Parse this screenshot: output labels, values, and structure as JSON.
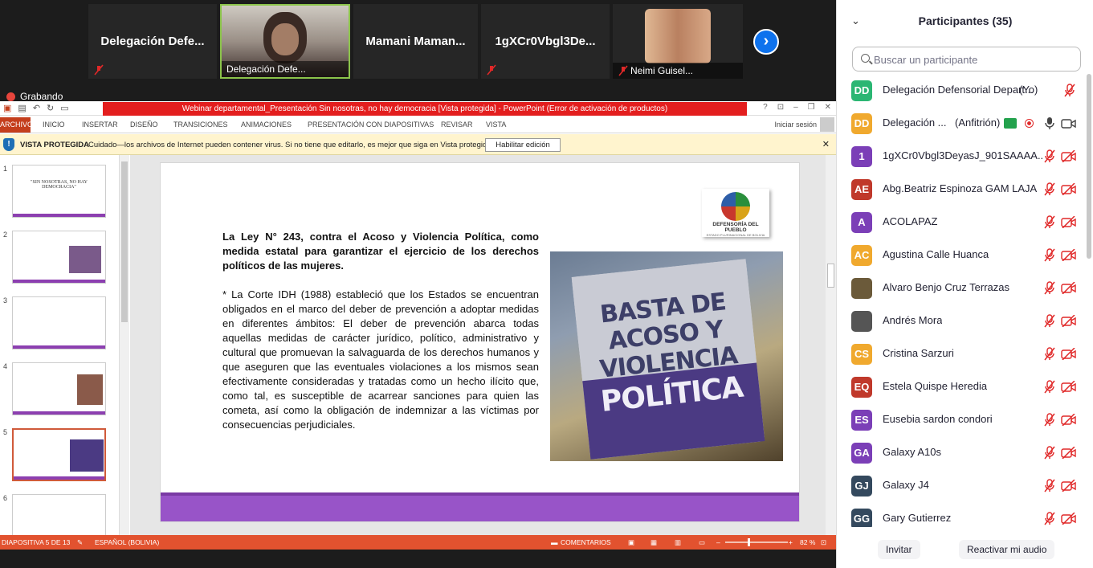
{
  "gallery": {
    "tiles": [
      {
        "name": "Delegación  Defe..."
      },
      {
        "caption": "Delegación Defe..."
      },
      {
        "name": "Mamani  Maman..."
      },
      {
        "name": "1gXCr0Vbgl3De..."
      },
      {
        "caption": "Neimi Guisel..."
      }
    ],
    "next_label": "›",
    "recording_label": "Grabando"
  },
  "ppt": {
    "window_title": "Webinar departamental_Presentación Sin nosotras, no hay democracia [Vista protegida] -  PowerPoint (Error de activación de productos)",
    "window_controls": [
      "?",
      "⊡",
      "–",
      "❐",
      "✕"
    ],
    "tabs": [
      "ARCHIVO",
      "INICIO",
      "INSERTAR",
      "DISEÑO",
      "TRANSICIONES",
      "ANIMACIONES",
      "PRESENTACIÓN CON DIAPOSITIVAS",
      "REVISAR",
      "VISTA"
    ],
    "signin": "Iniciar sesión",
    "warning": {
      "title": "VISTA PROTEGIDA",
      "text": "Cuidado—los archivos de Internet pueden contener virus. Si no tiene que editarlo, es mejor que siga en Vista protegida.",
      "button": "Habilitar edición",
      "close": "✕"
    },
    "thumbs": [
      {
        "num": "1",
        "text": "\"SIN NOSOTRAS, NO HAY DEMOCRACIA\""
      },
      {
        "num": "2",
        "text": ""
      },
      {
        "num": "3",
        "text": ""
      },
      {
        "num": "4",
        "text": ""
      },
      {
        "num": "5",
        "text": ""
      },
      {
        "num": "6",
        "text": ""
      }
    ],
    "slide": {
      "heading": "La Ley N° 243, contra el Acoso y Violencia Política, como medida estatal para garantizar el ejercicio de los derechos políticos de las mujeres.",
      "body": "* La Corte IDH (1988) estableció que los Estados se encuentran obligados en el marco del deber de prevención a adoptar medidas en diferentes ámbitos: El deber de prevención abarca todas aquellas medidas de carácter jurídico, político, administrativo y cultural que promuevan la salvaguarda de los derechos humanos y que aseguren que las eventuales violaciones a los mismos sean efectivamente consideradas y tratadas como un hecho ilícito que, como tal, es susceptible de acarrear sanciones para quien las cometa, así como la obligación de indemnizar a las víctimas por consecuencias perjudiciales.",
      "logo_line1": "DEFENSORÍA DEL PUEBLO",
      "logo_line2": "ESTADO PLURINACIONAL DE BOLIVIA",
      "sign_line1": "BASTA DE ACOSO Y VIOLENCIA",
      "sign_line2": "POLÍTICA"
    },
    "status": {
      "slide_info": "DIAPOSITIVA 5 DE 13",
      "language": "ESPAÑOL (BOLIVIA)",
      "comments": "COMENTARIOS",
      "zoom": "82 %"
    }
  },
  "participants": {
    "title": "Participantes (35)",
    "search_placeholder": "Buscar un participante",
    "list": [
      {
        "initials": "DD",
        "color": "#2bb673",
        "name": "Delegación Defensorial Depart...",
        "extra": "(Yo)"
      },
      {
        "initials": "DD",
        "color": "#f0a92e",
        "name": "Delegación ...",
        "extra": "(Anfitrión)"
      },
      {
        "initials": "1",
        "color": "#7b3fb7",
        "name": "1gXCr0Vbgl3DeyasJ_901SAAAA..."
      },
      {
        "initials": "AE",
        "color": "#c0392b",
        "name": "Abg.Beatriz Espinoza GAM LAJA"
      },
      {
        "initials": "A",
        "color": "#7b3fb7",
        "name": "ACOLAPAZ"
      },
      {
        "initials": "AC",
        "color": "#f0a92e",
        "name": "Agustina Calle Huanca"
      },
      {
        "initials": "",
        "color": "#6b5a3a",
        "name": "Alvaro Benjo Cruz Terrazas"
      },
      {
        "initials": "",
        "color": "#555555",
        "name": "Andrés Mora"
      },
      {
        "initials": "CS",
        "color": "#f0a92e",
        "name": "Cristina Sarzuri"
      },
      {
        "initials": "EQ",
        "color": "#c0392b",
        "name": "Estela Quispe Heredia"
      },
      {
        "initials": "ES",
        "color": "#7b3fb7",
        "name": "Eusebia sardon condori"
      },
      {
        "initials": "GA",
        "color": "#7b3fb7",
        "name": "Galaxy A10s"
      },
      {
        "initials": "GJ",
        "color": "#34495e",
        "name": "Galaxy J4"
      },
      {
        "initials": "GG",
        "color": "#34495e",
        "name": "Gary Gutierrez"
      }
    ],
    "invite": "Invitar",
    "unmute": "Reactivar mi audio"
  }
}
